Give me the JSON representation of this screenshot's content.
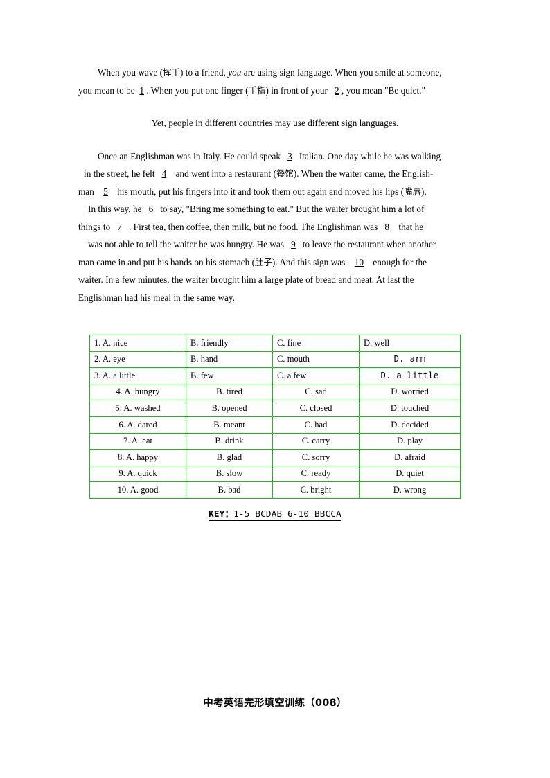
{
  "document": {
    "passage": {
      "paragraph1": {
        "line1": "When you wave (挥手) to a friend, you are using sign language. When you smile at someone,",
        "line2_a": "you mean to be",
        "blank1": "1",
        "line2_b": ". When you put one finger (手指) in front of your",
        "blank2": "2",
        "line2_c": ", you mean \"Be quiet.\""
      },
      "paragraph2": {
        "text": "Yet, people in different countries may use different sign languages."
      },
      "paragraph3": {
        "line1_a": "Once an Englishman was in Italy. He could speak",
        "blank3": "3",
        "line1_b": "Italian. One day while he was walking",
        "line2_a": "in the street, he felt",
        "blank4": "4",
        "line2_b": "and went into a restaurant (餐馆). When the waiter came, the English-",
        "line3_a": "man",
        "blank5": "5",
        "line3_b": "his mouth, put his fingers into it and took them out again and moved his lips (嘴唇).",
        "line4_a": "In this way, he",
        "blank6": "6",
        "line4_b": "to say, \"Bring me something to eat.\" But the waiter brought him a lot of",
        "line5_a": "things to",
        "blank7": "7",
        "line5_b": ". First tea, then coffee, then milk, but no food. The Englishman was",
        "blank8": "8",
        "line5_c": "that he",
        "line6_a": "was not able to tell the waiter he was hungry. He was",
        "blank9": "9",
        "line6_b": "to leave the restaurant when another",
        "line7_a": "man came in and put his hands on his stomach (肚子). And this sign was",
        "blank10": "10",
        "line7_b": "enough for the",
        "line8": "waiter. In a few minutes, the waiter brought him a large plate of bread and meat. At last the",
        "line9": "Englishman had his meal in the same way."
      }
    },
    "options_table": {
      "border_color": "#00cc00",
      "rows": [
        {
          "number": "1.",
          "a": "1. A. nice",
          "b": "B. friendly",
          "c": "C. fine",
          "d": "D. well",
          "align": "left",
          "d_mono": false
        },
        {
          "number": "2.",
          "a": "2. A. eye",
          "b": "B. hand",
          "c": "C. mouth",
          "d": "D. arm",
          "align": "left",
          "d_mono": true
        },
        {
          "number": "3.",
          "a": "3. A. a little",
          "b": "B. few",
          "c": "C. a few",
          "d": "D. a little",
          "align": "left",
          "d_mono": true
        },
        {
          "number": "4.",
          "a": "4. A. hungry",
          "b": "B. tired",
          "c": "C. sad",
          "d": "D. worried",
          "align": "center",
          "d_mono": false
        },
        {
          "number": "5.",
          "a": "5. A. washed",
          "b": "B. opened",
          "c": "C. closed",
          "d": "D. touched",
          "align": "center",
          "d_mono": false
        },
        {
          "number": "6.",
          "a": "6. A. dared",
          "b": "B. meant",
          "c": "C. had",
          "d": "D. decided",
          "align": "center",
          "d_mono": false
        },
        {
          "number": "7.",
          "a": "7. A. eat",
          "b": "B. drink",
          "c": "C. carry",
          "d": "D. play",
          "align": "center",
          "d_mono": false
        },
        {
          "number": "8.",
          "a": "8. A. happy",
          "b": "B. glad",
          "c": "C. sorry",
          "d": "D. afraid",
          "align": "center",
          "d_mono": false
        },
        {
          "number": "9.",
          "a": "9. A. quick",
          "b": "B. slow",
          "c": "C. ready",
          "d": "D. quiet",
          "align": "center",
          "d_mono": false
        },
        {
          "number": "10.",
          "a": "10. A. good",
          "b": "B. bad",
          "c": "C. bright",
          "d": "D. wrong",
          "align": "center",
          "d_mono": false
        }
      ]
    },
    "answer_key": {
      "label": "KEY：",
      "answers": "1-5 BCDAB  6-10 BBCCA"
    },
    "footer": {
      "title": "中考英语完形填空训练（008）"
    }
  }
}
